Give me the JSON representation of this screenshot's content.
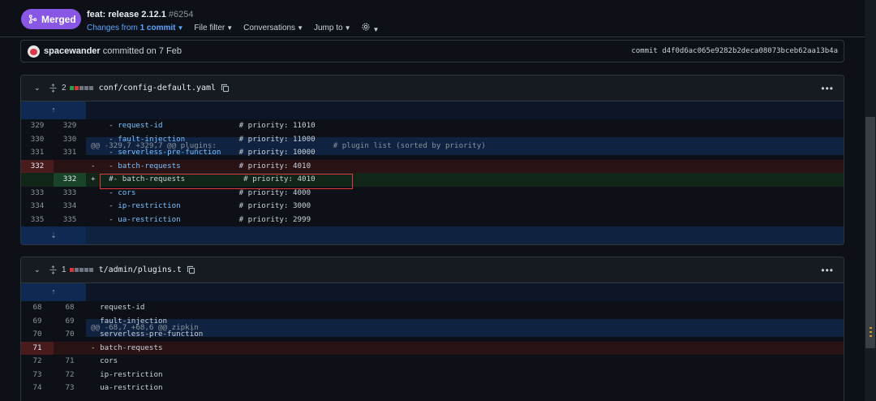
{
  "header": {
    "badge_label": "Merged",
    "title": "feat: release 2.12.1",
    "number": "#6254",
    "toolbar": {
      "changes_prefix": "Changes from",
      "changes_link": "1 commit",
      "file_filter": "File filter",
      "conversations": "Conversations",
      "jump_to": "Jump to"
    }
  },
  "commit": {
    "author": "spacewander",
    "text": "committed on 7 Feb",
    "sha": "commit d4f0d6ac065e9282b2deca08073bceb62aa13b4a"
  },
  "files": [
    {
      "changes": "2",
      "blocks": [
        "#2ea043",
        "#da3633",
        "#6e7681",
        "#6e7681",
        "#6e7681"
      ],
      "name": "conf/config-default.yaml",
      "hunk": "@@ -329,7 +329,7 @@ plugins:                          # plugin list (sorted by priority)",
      "lines": [
        {
          "old": "329",
          "new": "329",
          "sign": " ",
          "prefix": "  - ",
          "key": "request-id",
          "pad": "                 ",
          "comment": "# priority: 11010",
          "type": "ctx"
        },
        {
          "old": "330",
          "new": "330",
          "sign": " ",
          "prefix": "  - ",
          "key": "fault-injection",
          "pad": "            ",
          "comment": "# priority: 11000",
          "type": "ctx"
        },
        {
          "old": "331",
          "new": "331",
          "sign": " ",
          "prefix": "  - ",
          "key": "serverless-pre-function",
          "pad": "    ",
          "comment": "# priority: 10000",
          "type": "ctx"
        },
        {
          "old": "332",
          "new": "",
          "sign": "-",
          "prefix": "  - ",
          "key": "batch-requests",
          "pad": "             ",
          "comment": "# priority: 4010",
          "type": "del"
        },
        {
          "old": "",
          "new": "332",
          "sign": "+",
          "prefix": "  #- ",
          "key": "batch-requests",
          "pad": "             ",
          "comment": "# priority: 4010",
          "type": "add"
        },
        {
          "old": "333",
          "new": "333",
          "sign": " ",
          "prefix": "  - ",
          "key": "cors",
          "pad": "                       ",
          "comment": "# priority: 4000",
          "type": "ctx"
        },
        {
          "old": "334",
          "new": "334",
          "sign": " ",
          "prefix": "  - ",
          "key": "ip-restriction",
          "pad": "             ",
          "comment": "# priority: 3000",
          "type": "ctx"
        },
        {
          "old": "335",
          "new": "335",
          "sign": " ",
          "prefix": "  - ",
          "key": "ua-restriction",
          "pad": "             ",
          "comment": "# priority: 2999",
          "type": "ctx"
        }
      ]
    },
    {
      "changes": "1",
      "blocks": [
        "#da3633",
        "#6e7681",
        "#6e7681",
        "#6e7681",
        "#6e7681"
      ],
      "name": "t/admin/plugins.t",
      "hunk": "@@ -68,7 +68,6 @@ zipkin",
      "lines": [
        {
          "old": "68",
          "new": "68",
          "sign": " ",
          "text": "request-id",
          "type": "ctx"
        },
        {
          "old": "69",
          "new": "69",
          "sign": " ",
          "text": "fault-injection",
          "type": "ctx"
        },
        {
          "old": "70",
          "new": "70",
          "sign": " ",
          "text": "serverless-pre-function",
          "type": "ctx"
        },
        {
          "old": "71",
          "new": "",
          "sign": "-",
          "text": "batch-requests",
          "type": "del"
        },
        {
          "old": "72",
          "new": "71",
          "sign": " ",
          "text": "cors",
          "type": "ctx"
        },
        {
          "old": "73",
          "new": "72",
          "sign": " ",
          "text": "ip-restriction",
          "type": "ctx"
        },
        {
          "old": "74",
          "new": "73",
          "sign": " ",
          "text": "ua-restriction",
          "type": "ctx"
        }
      ]
    }
  ]
}
